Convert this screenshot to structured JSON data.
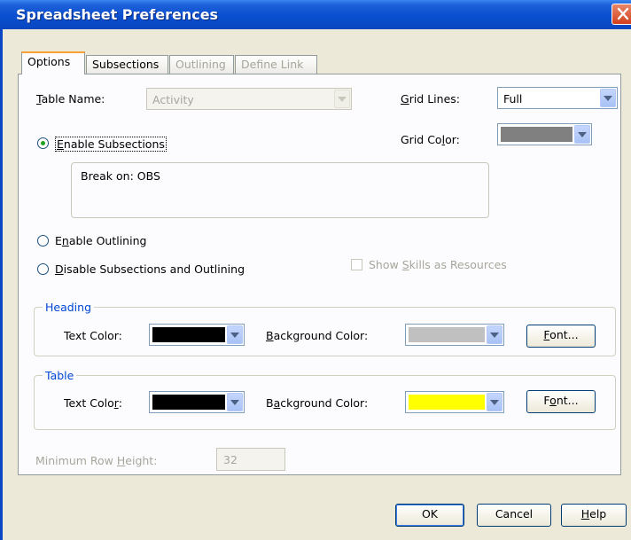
{
  "window": {
    "title": "Spreadsheet Preferences"
  },
  "tabs": [
    {
      "label": "Options",
      "state": "active"
    },
    {
      "label": "Subsections",
      "state": "normal"
    },
    {
      "label": "Outlining",
      "state": "disabled"
    },
    {
      "label": "Define Link",
      "state": "disabled"
    }
  ],
  "options": {
    "table_name_label": "Table Name:",
    "table_name_value": "Activity",
    "grid_lines_label": "Grid Lines:",
    "grid_lines_value": "Full",
    "grid_color_label": "Grid Color:",
    "grid_color": "#808080",
    "radio_enable_subsections": "Enable Subsections",
    "radio_enable_outlining": "Enable Outlining",
    "radio_disable_both": "Disable Subsections and Outlining",
    "selected_radio": "enable_subsections",
    "break_on_text": "Break on:  OBS",
    "show_skills_label": "Show Skills as Resources",
    "show_skills_checked": false
  },
  "heading": {
    "group_label": "Heading",
    "text_color_label": "Text Color:",
    "text_color": "#000000",
    "bg_color_label": "Background Color:",
    "bg_color": "#c0c0c0",
    "font_button": "Font..."
  },
  "table": {
    "group_label": "Table",
    "text_color_label": "Text Color:",
    "text_color": "#000000",
    "bg_color_label": "Background Color:",
    "bg_color": "#ffff00",
    "font_button": "Font..."
  },
  "min_row_height": {
    "label": "Minimum Row Height:",
    "value": "32"
  },
  "buttons": {
    "ok": "OK",
    "cancel": "Cancel",
    "help": "Help"
  }
}
